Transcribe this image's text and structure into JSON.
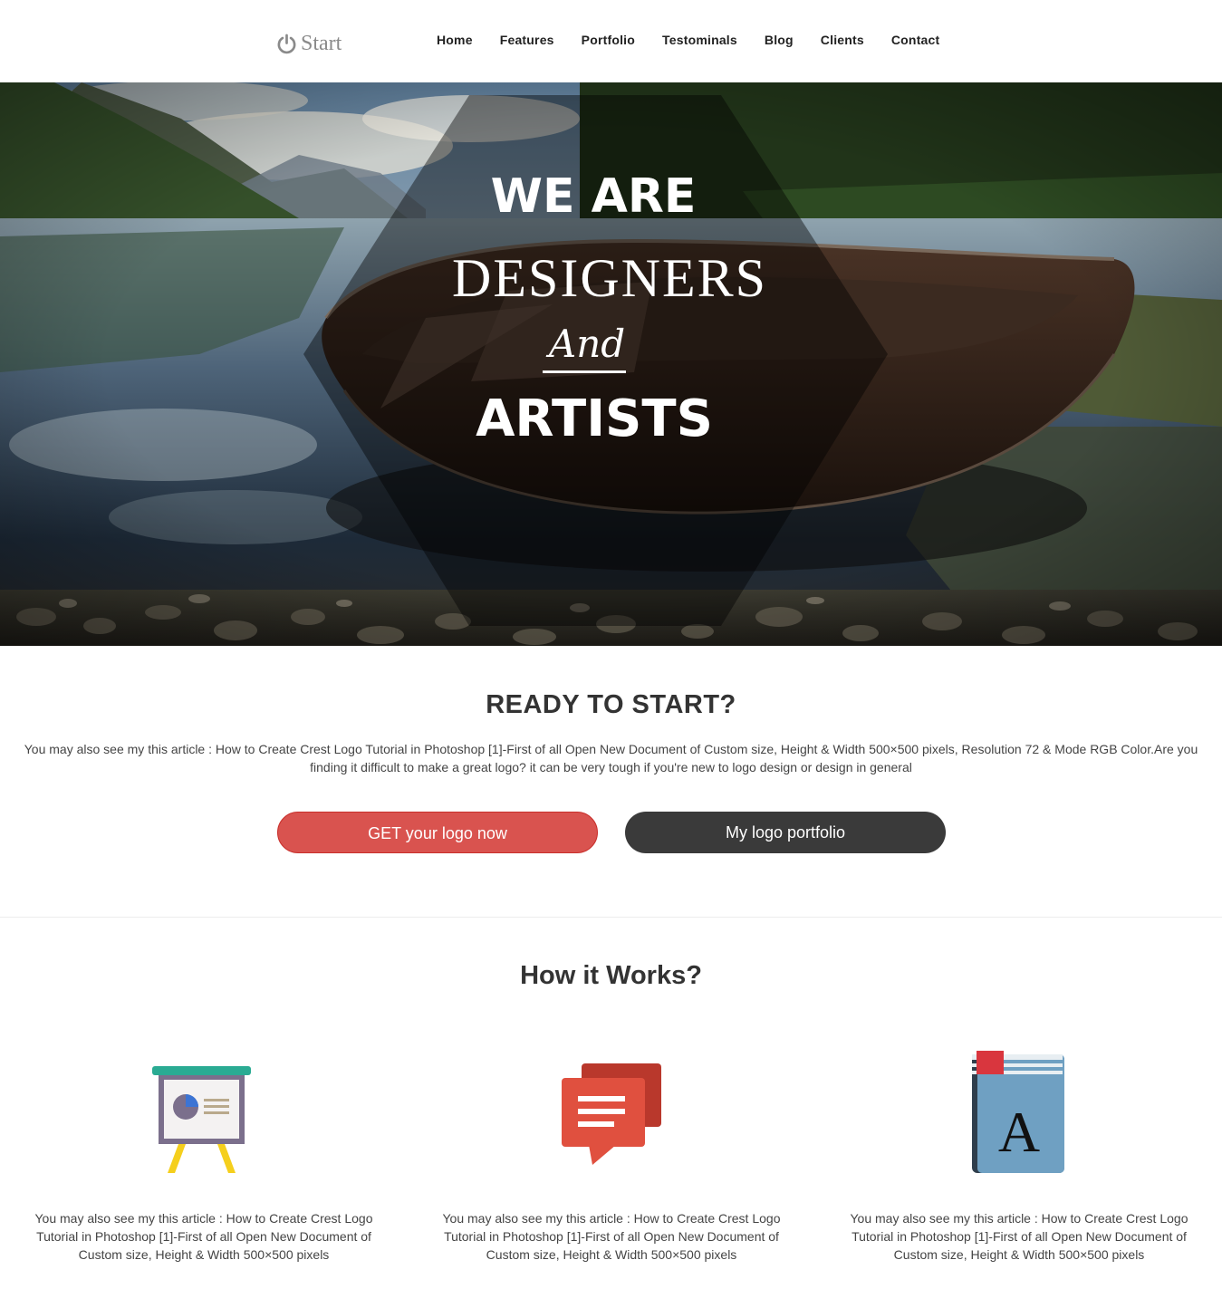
{
  "header": {
    "logo_text": "Start",
    "logo_icon": "power-icon",
    "nav": [
      "Home",
      "Features",
      "Portfolio",
      "Testominals",
      "Blog",
      "Clients",
      "Contact"
    ]
  },
  "hero": {
    "line1": "WE ARE",
    "line2": "DESIGNERS",
    "line3": "And",
    "line4": "ARTISTS"
  },
  "ready": {
    "title": "READY TO START?",
    "text": "You may also see my this article : How to Create Crest Logo Tutorial in Photoshop [1]-First of all Open New Document of Custom size, Height & Width 500×500 pixels, Resolution 72 & Mode RGB Color.Are you finding it difficult to make a great logo? it can be very tough if you're new to logo design or design in general",
    "primary_button": "GET your logo now",
    "secondary_button": "My logo portfolio"
  },
  "how": {
    "title": "How it Works?",
    "features": [
      {
        "icon": "presentation-board-icon",
        "text": "You may also see my this article : How to Create Crest Logo Tutorial in Photoshop [1]-First of all Open New Document of Custom size, Height & Width 500×500 pixels"
      },
      {
        "icon": "chat-bubbles-icon",
        "text": "You may also see my this article : How to Create Crest Logo Tutorial in Photoshop [1]-First of all Open New Document of Custom size, Height & Width 500×500 pixels"
      },
      {
        "icon": "font-book-icon",
        "text": "You may also see my this article : How to Create Crest Logo Tutorial in Photoshop [1]-First of all Open New Document of Custom size, Height & Width 500×500 pixels",
        "glyph": "A"
      }
    ]
  },
  "colors": {
    "primary_button": "#d9534f",
    "secondary_button": "#3a3a3a"
  }
}
